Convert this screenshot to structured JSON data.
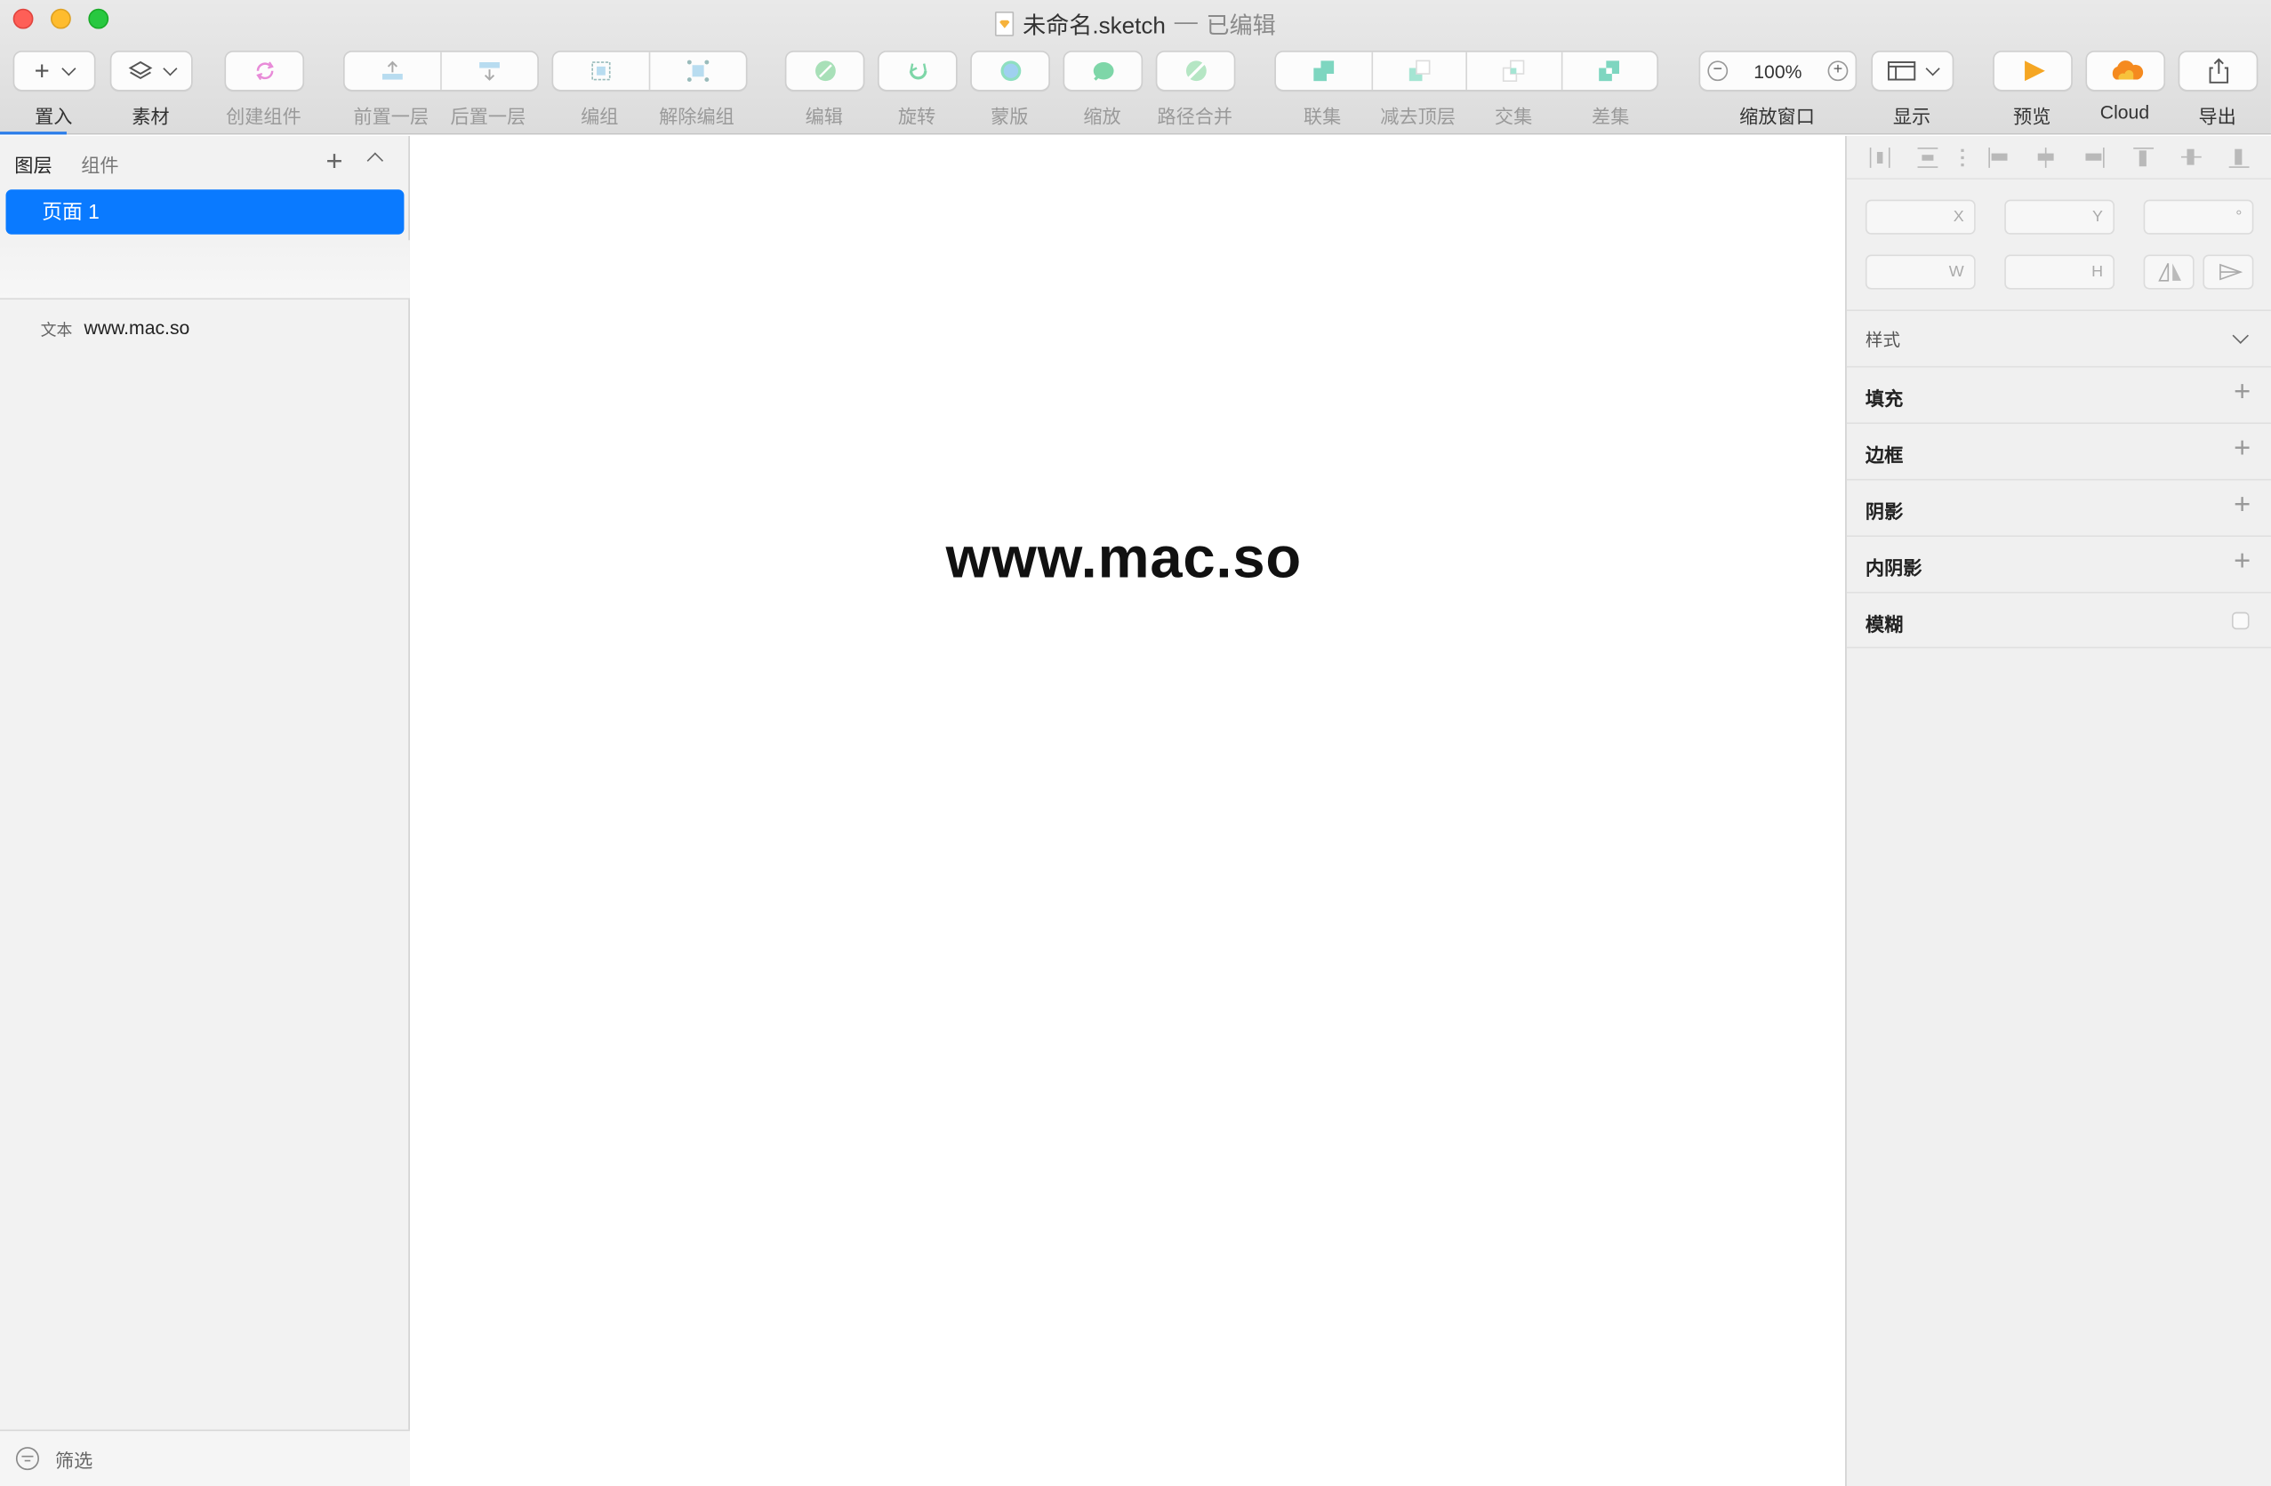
{
  "window": {
    "filename": "未命名.sketch",
    "separator": "—",
    "status": "已编辑"
  },
  "toolbar": {
    "insert": "置入",
    "assets": "素材",
    "create_symbol": "创建组件",
    "forward": "前置一层",
    "backward": "后置一层",
    "group": "编组",
    "ungroup": "解除编组",
    "edit": "编辑",
    "rotate": "旋转",
    "mask": "蒙版",
    "scale": "缩放",
    "flatten": "路径合并",
    "union": "联集",
    "subtract": "减去顶层",
    "intersect": "交集",
    "difference": "差集",
    "zoom_value": "100%",
    "zoom_label": "缩放窗口",
    "view": "显示",
    "preview": "预览",
    "cloud": "Cloud",
    "export": "导出",
    "zoom_minus": "−",
    "zoom_plus": "+"
  },
  "sidebar": {
    "tab_layers": "图层",
    "tab_components": "组件",
    "page": "页面 1",
    "layer_kind": "文本",
    "layer_name": "www.mac.so",
    "filter": "筛选"
  },
  "canvas": {
    "text": "www.mac.so"
  },
  "inspector": {
    "x": "X",
    "y": "Y",
    "rotation": "°",
    "w": "W",
    "h": "H",
    "style": "样式",
    "fill": "填充",
    "border": "边框",
    "shadow": "阴影",
    "inner_shadow": "内阴影",
    "blur": "模糊"
  },
  "colors": {
    "accent": "#0a7aff",
    "icon_green": "#7ed6a8",
    "icon_pink": "#e88bd8",
    "preview_orange": "#f5a623"
  }
}
